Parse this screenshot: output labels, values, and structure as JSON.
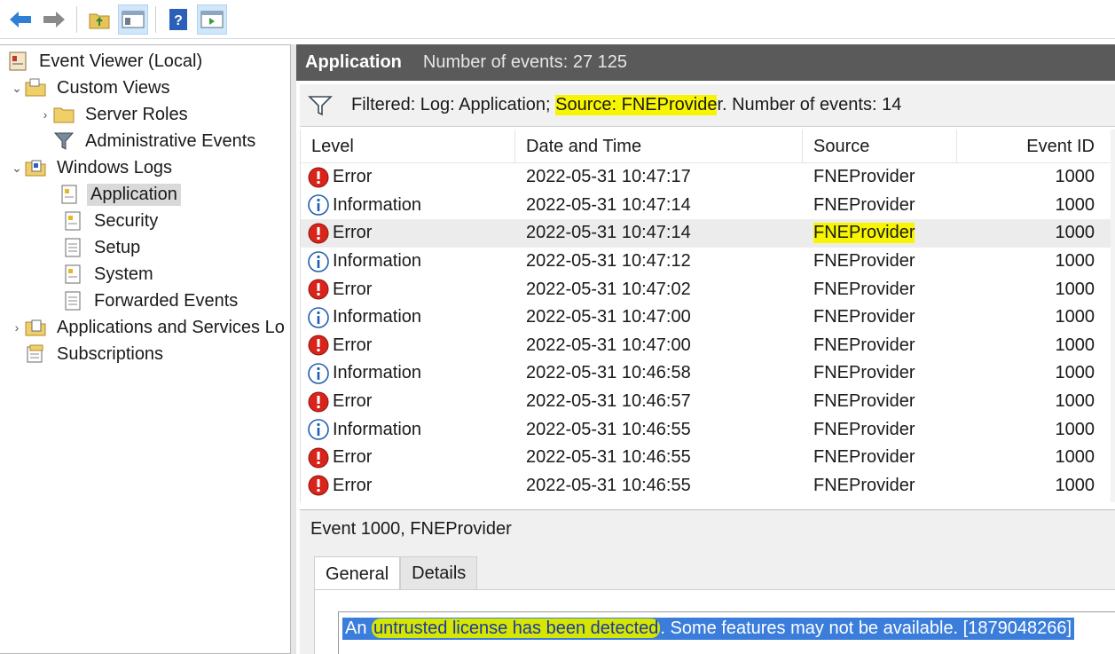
{
  "toolbar": {
    "buttons": [
      {
        "name": "back-button",
        "icon": "back-arrow-icon"
      },
      {
        "name": "forward-button",
        "icon": "forward-arrow-icon"
      },
      {
        "name": "up-level-button",
        "icon": "folder-up-icon"
      },
      {
        "name": "show-hide-console-tree-button",
        "icon": "console-tree-icon"
      },
      {
        "name": "help-button",
        "icon": "help-icon"
      },
      {
        "name": "show-hide-action-pane-button",
        "icon": "action-pane-icon"
      }
    ]
  },
  "tree": {
    "root": "Event Viewer (Local)",
    "custom_views": "Custom Views",
    "server_roles": "Server Roles",
    "administrative_events": "Administrative Events",
    "windows_logs": "Windows Logs",
    "application": "Application",
    "security": "Security",
    "setup": "Setup",
    "system": "System",
    "forwarded_events": "Forwarded Events",
    "apps_services": "Applications and Services Lo",
    "subscriptions": "Subscriptions"
  },
  "header": {
    "title": "Application",
    "count": "Number of events: 27 125"
  },
  "filter": {
    "prefix": "Filtered: Log: Application; ",
    "highlighted": "Source: FNEProvide",
    "suffix": "r. Number of events: 14"
  },
  "table": {
    "columns": [
      "Level",
      "Date and Time",
      "Source",
      "Event ID"
    ],
    "rows": [
      {
        "level": "Error",
        "date": "2022-05-31 10:47:17",
        "source": "FNEProvider",
        "event_id": "1000"
      },
      {
        "level": "Information",
        "date": "2022-05-31 10:47:14",
        "source": "FNEProvider",
        "event_id": "1000"
      },
      {
        "level": "Error",
        "date": "2022-05-31 10:47:14",
        "source": "FNEProvider",
        "event_id": "1000"
      },
      {
        "level": "Information",
        "date": "2022-05-31 10:47:12",
        "source": "FNEProvider",
        "event_id": "1000"
      },
      {
        "level": "Error",
        "date": "2022-05-31 10:47:02",
        "source": "FNEProvider",
        "event_id": "1000"
      },
      {
        "level": "Information",
        "date": "2022-05-31 10:47:00",
        "source": "FNEProvider",
        "event_id": "1000"
      },
      {
        "level": "Error",
        "date": "2022-05-31 10:47:00",
        "source": "FNEProvider",
        "event_id": "1000"
      },
      {
        "level": "Information",
        "date": "2022-05-31 10:46:58",
        "source": "FNEProvider",
        "event_id": "1000"
      },
      {
        "level": "Error",
        "date": "2022-05-31 10:46:57",
        "source": "FNEProvider",
        "event_id": "1000"
      },
      {
        "level": "Information",
        "date": "2022-05-31 10:46:55",
        "source": "FNEProvider",
        "event_id": "1000"
      },
      {
        "level": "Error",
        "date": "2022-05-31 10:46:55",
        "source": "FNEProvider",
        "event_id": "1000"
      },
      {
        "level": "Error",
        "date": "2022-05-31 10:46:55",
        "source": "FNEProvider",
        "event_id": "1000"
      }
    ]
  },
  "detail": {
    "title": "Event 1000, FNEProvider",
    "tabs": [
      "General",
      "Details"
    ],
    "message_start": "An ",
    "message_mark": "untrusted license has been detected",
    "message_end": ". Some features may not be available. [1879048266]"
  },
  "colors": {
    "header_bg": "#5a5a5a",
    "highlight_yellow": "#f7f500",
    "selection_blue": "#3b7ddb",
    "error_red": "#d9241c",
    "info_blue": "#1f5fb3"
  }
}
